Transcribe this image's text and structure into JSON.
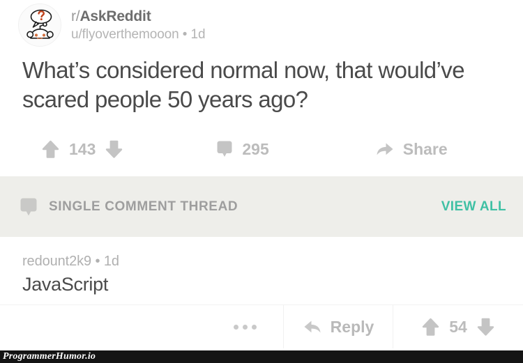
{
  "post": {
    "avatar_icon": "askreddit-snoo-avatar",
    "subreddit_prefix": "r/",
    "subreddit_name": "AskReddit",
    "author_line": "u/flyoverthemooon • 1d",
    "title": "What’s considered normal now, that would’ve scared people 50 years ago?",
    "actions": {
      "upvote_icon": "upvote-arrow-icon",
      "score": "143",
      "downvote_icon": "downvote-arrow-icon",
      "comment_icon": "comment-bubble-icon",
      "comment_count": "295",
      "share_icon": "share-arrow-icon",
      "share_label": "Share"
    }
  },
  "thread_banner": {
    "icon": "comment-bubble-icon",
    "label": "SINGLE COMMENT THREAD",
    "view_all_label": "VIEW ALL",
    "accent_color": "#3fc0a4",
    "background_color": "#eeeeea"
  },
  "comment": {
    "meta": "redount2k9 • 1d",
    "body": "JavaScript",
    "actions": {
      "more_icon": "ellipsis-icon",
      "reply_icon": "reply-arrow-icon",
      "reply_label": "Reply",
      "upvote_icon": "upvote-arrow-icon",
      "score": "54",
      "downvote_icon": "downvote-arrow-icon"
    }
  },
  "watermark": {
    "text": "ProgrammerHumor.io",
    "background_color": "#141414"
  }
}
